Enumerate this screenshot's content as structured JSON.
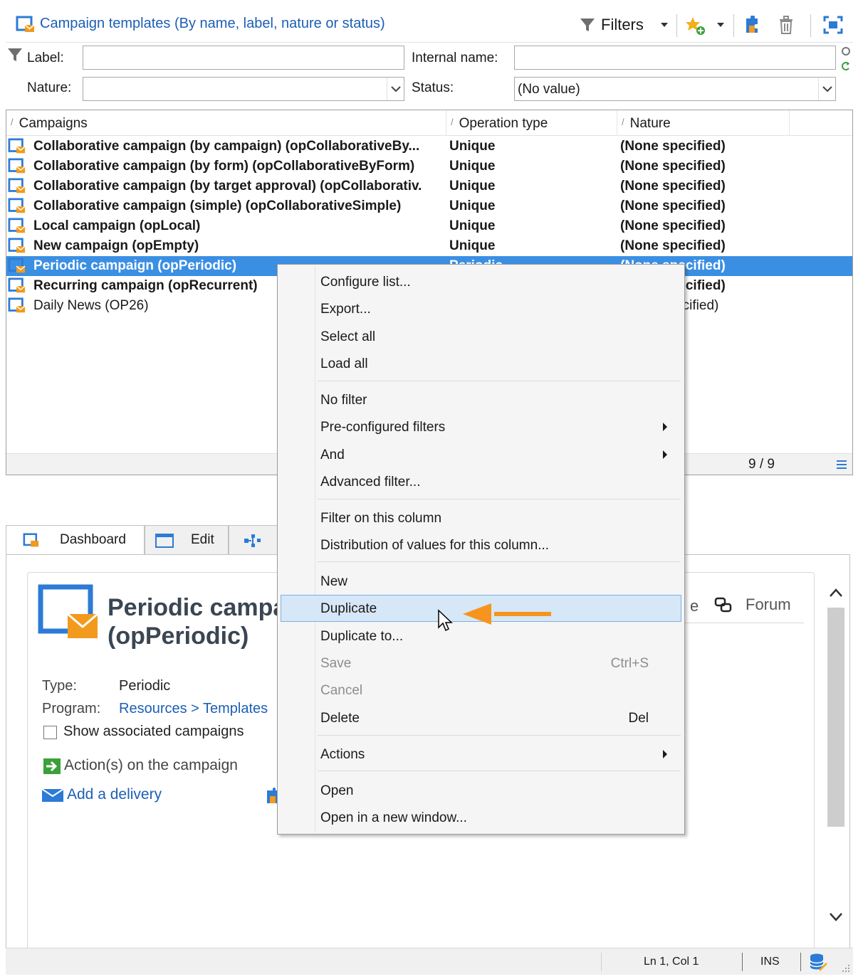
{
  "header": {
    "title": "Campaign templates (By name, label, nature or status)",
    "filters_label": "Filters"
  },
  "filters": {
    "label_label": "Label:",
    "label_value": "",
    "internal_name_label": "Internal name:",
    "internal_name_value": "",
    "nature_label": "Nature:",
    "nature_value": "",
    "status_label": "Status:",
    "status_value": "(No value)"
  },
  "grid": {
    "columns": [
      "Campaigns",
      "Operation type",
      "Nature"
    ],
    "rows": [
      {
        "name": "Collaborative campaign (by campaign) (opCollaborativeBy...",
        "type": "Unique",
        "nature": "(None specified)"
      },
      {
        "name": "Collaborative campaign (by form) (opCollaborativeByForm)",
        "type": "Unique",
        "nature": "(None specified)"
      },
      {
        "name": "Collaborative campaign (by target approval) (opCollaborativ.",
        "type": "Unique",
        "nature": "(None specified)"
      },
      {
        "name": "Collaborative campaign (simple) (opCollaborativeSimple)",
        "type": "Unique",
        "nature": "(None specified)"
      },
      {
        "name": "Local campaign (opLocal)",
        "type": "Unique",
        "nature": "(None specified)"
      },
      {
        "name": "New campaign (opEmpty)",
        "type": "Unique",
        "nature": "(None specified)"
      },
      {
        "name": "Periodic campaign (opPeriodic)",
        "type": "Periodic",
        "nature": "(None specified)"
      },
      {
        "name": "Recurring campaign (opRecurrent)",
        "type": "",
        "nature": "(None specified)"
      },
      {
        "name": "Daily News (OP26)",
        "type": "",
        "nature": "(None specified)"
      }
    ],
    "count": "9 / 9"
  },
  "tabs": {
    "dashboard": "Dashboard",
    "edit": "Edit"
  },
  "dashboard": {
    "title_line1": "Periodic campaign",
    "title_line2": "(opPeriodic)",
    "type_label": "Type:",
    "type_value": "Periodic",
    "program_label": "Program:",
    "program_value": "Resources > Templates",
    "show_associated": "Show associated campaigns",
    "actions_heading": "Action(s) on the campaign",
    "add_delivery": "Add a delivery",
    "forum": "Forum",
    "partial_e": "e"
  },
  "context_menu": {
    "items": [
      {
        "label": "Configure list..."
      },
      {
        "label": "Export..."
      },
      {
        "label": "Select all"
      },
      {
        "label": "Load all"
      },
      {
        "label": "No filter"
      },
      {
        "label": "Pre-configured filters"
      },
      {
        "label": "And"
      },
      {
        "label": "Advanced filter..."
      },
      {
        "label": "Filter on this column"
      },
      {
        "label": "Distribution of values for this column..."
      },
      {
        "label": "New"
      },
      {
        "label": "Duplicate"
      },
      {
        "label": "Duplicate to..."
      },
      {
        "label": "Save",
        "shortcut": "Ctrl+S"
      },
      {
        "label": "Cancel"
      },
      {
        "label": "Delete",
        "shortcut": "Del"
      },
      {
        "label": "Actions"
      },
      {
        "label": "Open"
      },
      {
        "label": "Open in a new window..."
      }
    ]
  },
  "statusbar": {
    "position": "Ln 1, Col 1",
    "mode": "INS"
  },
  "colors": {
    "accent_blue": "#1c5fb5",
    "selection_blue": "#3b8fe3",
    "icon_orange": "#f29a1d",
    "arrow_orange": "#f7941d"
  }
}
